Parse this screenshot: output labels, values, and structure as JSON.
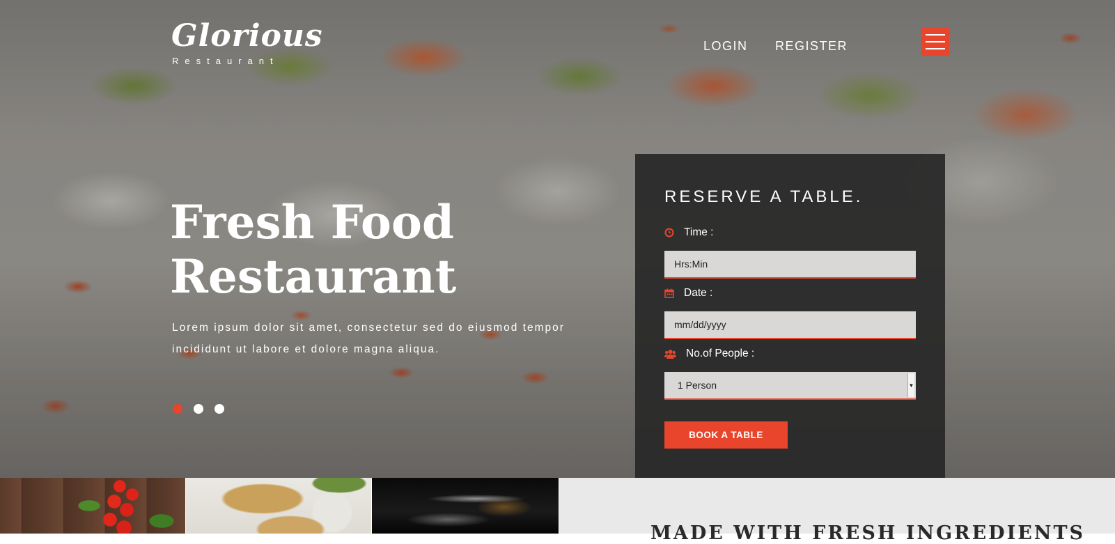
{
  "brand": {
    "name": "Glorious",
    "tagline": "Restaurant"
  },
  "nav": {
    "login": "LOGIN",
    "register": "REGISTER",
    "menu_icon": "hamburger-menu-icon"
  },
  "hero": {
    "title_line1": "Fresh Food",
    "title_line2": "Restaurant",
    "description": "Lorem ipsum dolor sit amet, consectetur sed do eiusmod tempor incididunt ut labore et dolore magna aliqua.",
    "slides": 3,
    "active_slide": 1
  },
  "reservation": {
    "title": "RESERVE A TABLE.",
    "time": {
      "label": "Time :",
      "placeholder": "Hrs:Min",
      "icon": "clock-icon"
    },
    "date": {
      "label": "Date :",
      "placeholder": "mm/dd/yyyy",
      "icon": "calendar-icon"
    },
    "people": {
      "label": "No.of People :",
      "selected": "1 Person",
      "icon": "users-icon"
    },
    "button": "BOOK A TABLE"
  },
  "section": {
    "title": "MADE WITH FRESH INGREDIENTS"
  },
  "colors": {
    "accent": "#e8452c",
    "panel": "#2b2b2b",
    "field": "#d9d8d6"
  }
}
